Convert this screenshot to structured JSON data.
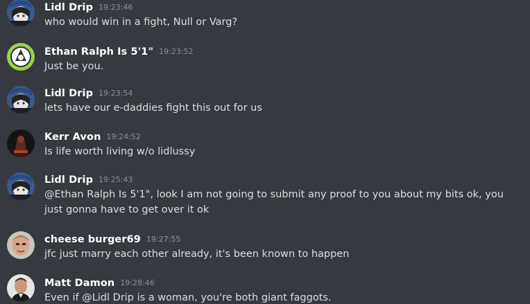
{
  "messages": [
    {
      "author": "Lidl Drip",
      "time": "19:23:46",
      "text": "who would win in a fight, Null or Varg?",
      "avatar": "anime-girl-avatar"
    },
    {
      "author": "Ethan Ralph Is 5'1\"",
      "time": "19:23:52",
      "text": "Just be you.",
      "avatar": "green-emblem-avatar"
    },
    {
      "author": "Lidl Drip",
      "time": "19:23:54",
      "text": "lets have our e-daddies fight this out for us",
      "avatar": "anime-girl-avatar"
    },
    {
      "author": "Kerr Avon",
      "time": "19:24:52",
      "text": "Is life worth living w/o lidlussy",
      "avatar": "dark-figure-avatar"
    },
    {
      "author": "Lidl Drip",
      "time": "19:25:43",
      "text": "@Ethan Ralph Is 5'1\", look I am not going to submit any proof to you about my bits ok, you just gonna have to get over it ok",
      "avatar": "anime-girl-avatar"
    },
    {
      "author": "cheese burger69",
      "time": "19:27:55",
      "text": "jfc just marry each other already, it's been known to happen",
      "avatar": "man-face-avatar"
    },
    {
      "author": "Matt Damon",
      "time": "19:28:46",
      "text": "Even if @Lidl Drip is a woman, you're both giant faggots.",
      "avatar": "man-portrait-avatar"
    }
  ],
  "colors": {
    "background": "#36393f",
    "author": "#ffffff",
    "timestamp": "#8e9297",
    "text": "#dcddde"
  }
}
